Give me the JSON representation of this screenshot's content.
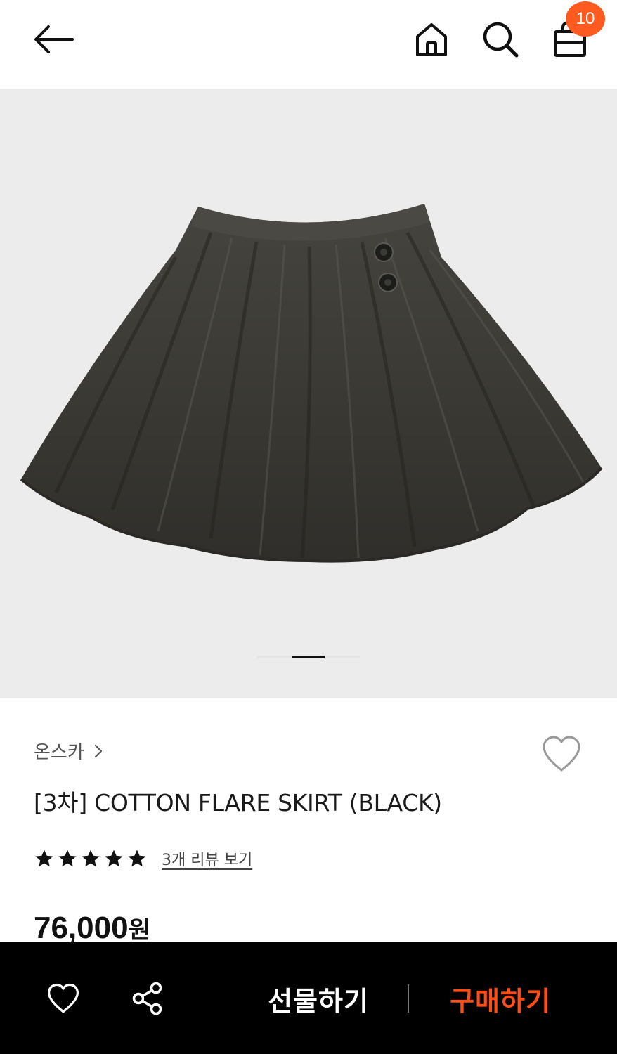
{
  "header": {
    "cart_badge_count": "10",
    "badge_color": "#ff5a1f"
  },
  "icons": {
    "back": "arrow-left-icon",
    "home": "home-icon",
    "search": "search-icon",
    "cart": "shopping-bag-icon",
    "wish": "heart-outline-icon",
    "share": "share-icon",
    "brand_chevron": "chevron-right-icon",
    "star": "star-filled-icon"
  },
  "gallery": {
    "current_slide": 2,
    "slide_count": 3
  },
  "product": {
    "brand": "온스카",
    "title": "[3차] COTTON FLARE SKIRT (BLACK)",
    "rating_stars": 5,
    "review_link": "3개 리뷰 보기",
    "price": "76,000",
    "price_unit": "원"
  },
  "bottom_bar": {
    "gift_label": "선물하기",
    "buy_label": "구매하기",
    "buy_color": "#ff4d14"
  }
}
